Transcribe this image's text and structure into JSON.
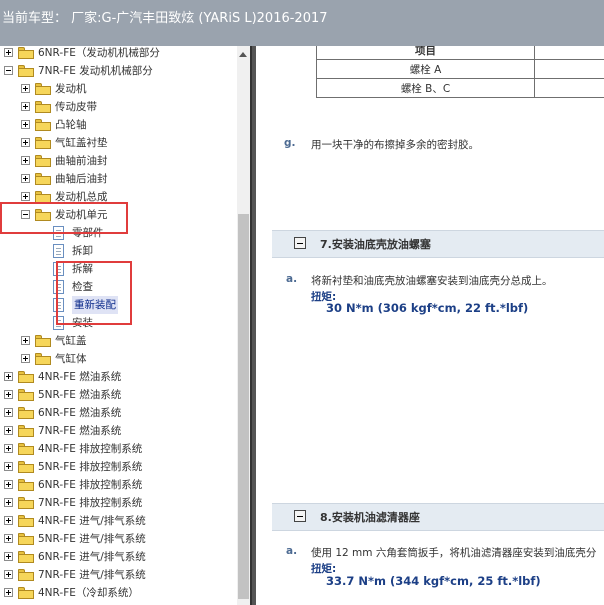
{
  "header": {
    "title": "当前车型：  厂家:G-广汽丰田致炫 (YARiS L)2016-2017"
  },
  "tree": [
    {
      "label": "6NR-FE（发动机机械部分",
      "level": 0,
      "expander": "plus",
      "icon": "folder"
    },
    {
      "label": "7NR-FE 发动机机械部分",
      "level": 0,
      "expander": "minus",
      "icon": "folder"
    },
    {
      "label": "发动机",
      "level": 1,
      "expander": "plus",
      "icon": "folder"
    },
    {
      "label": "传动皮带",
      "level": 1,
      "expander": "plus",
      "icon": "folder"
    },
    {
      "label": "凸轮轴",
      "level": 1,
      "expander": "plus",
      "icon": "folder"
    },
    {
      "label": "气缸盖衬垫",
      "level": 1,
      "expander": "plus",
      "icon": "folder"
    },
    {
      "label": "曲轴前油封",
      "level": 1,
      "expander": "plus",
      "icon": "folder"
    },
    {
      "label": "曲轴后油封",
      "level": 1,
      "expander": "plus",
      "icon": "folder"
    },
    {
      "label": "发动机总成",
      "level": 1,
      "expander": "plus",
      "icon": "folder"
    },
    {
      "label": "发动机单元",
      "level": 1,
      "expander": "minus",
      "icon": "folder"
    },
    {
      "label": "零部件",
      "level": 2,
      "expander": "none",
      "icon": "doc"
    },
    {
      "label": "拆卸",
      "level": 2,
      "expander": "none",
      "icon": "doc"
    },
    {
      "label": "拆解",
      "level": 2,
      "expander": "none",
      "icon": "doc"
    },
    {
      "label": "检查",
      "level": 2,
      "expander": "none",
      "icon": "doc"
    },
    {
      "label": "重新装配",
      "level": 2,
      "expander": "none",
      "icon": "doc",
      "selected": true
    },
    {
      "label": "安装",
      "level": 2,
      "expander": "none",
      "icon": "doc"
    },
    {
      "label": "气缸盖",
      "level": 1,
      "expander": "plus",
      "icon": "folder"
    },
    {
      "label": "气缸体",
      "level": 1,
      "expander": "plus",
      "icon": "folder"
    },
    {
      "label": "4NR-FE 燃油系统",
      "level": 0,
      "expander": "plus",
      "icon": "folder"
    },
    {
      "label": "5NR-FE 燃油系统",
      "level": 0,
      "expander": "plus",
      "icon": "folder"
    },
    {
      "label": "6NR-FE 燃油系统",
      "level": 0,
      "expander": "plus",
      "icon": "folder"
    },
    {
      "label": "7NR-FE 燃油系统",
      "level": 0,
      "expander": "plus",
      "icon": "folder"
    },
    {
      "label": "4NR-FE 排放控制系统",
      "level": 0,
      "expander": "plus",
      "icon": "folder"
    },
    {
      "label": "5NR-FE 排放控制系统",
      "level": 0,
      "expander": "plus",
      "icon": "folder"
    },
    {
      "label": "6NR-FE 排放控制系统",
      "level": 0,
      "expander": "plus",
      "icon": "folder"
    },
    {
      "label": "7NR-FE 排放控制系统",
      "level": 0,
      "expander": "plus",
      "icon": "folder"
    },
    {
      "label": "4NR-FE 进气/排气系统",
      "level": 0,
      "expander": "plus",
      "icon": "folder"
    },
    {
      "label": "5NR-FE 进气/排气系统",
      "level": 0,
      "expander": "plus",
      "icon": "folder"
    },
    {
      "label": "6NR-FE 进气/排气系统",
      "level": 0,
      "expander": "plus",
      "icon": "folder"
    },
    {
      "label": "7NR-FE 进气/排气系统",
      "level": 0,
      "expander": "plus",
      "icon": "folder"
    },
    {
      "label": "4NR-FE（冷却系统）",
      "level": 0,
      "expander": "plus",
      "icon": "folder"
    }
  ],
  "content": {
    "spec_table": {
      "header": "项目",
      "rows": [
        "螺栓 A",
        "螺栓 B、C"
      ]
    },
    "step_g": {
      "letter": "g.",
      "text": "用一块干净的布擦掉多余的密封胶。"
    },
    "section7": {
      "title": "7.安装油底壳放油螺塞",
      "letter": "a.",
      "text": "将新衬垫和油底壳放油螺塞安装到油底壳分总成上。",
      "torque_label": "扭矩:",
      "torque_value": "30 N*m (306 kgf*cm, 22 ft.*lbf)"
    },
    "section8": {
      "title": "8.安装机油滤清器座",
      "letter": "a.",
      "text": "使用 12 mm 六角套筒扳手，将机油滤清器座安装到油底壳分",
      "torque_label": "扭矩:",
      "torque_value": "33.7 N*m (344 kgf*cm, 25 ft.*lbf)"
    }
  },
  "colors": {
    "header_bg": "#9aa3ae",
    "highlight": "#e03c3c",
    "torque": "#1c3f86",
    "section_bar": "#e4ebf2"
  },
  "icons": {
    "folder": "folder-icon",
    "doc": "document-icon",
    "expand": "expand-icon",
    "collapse": "collapse-icon"
  }
}
